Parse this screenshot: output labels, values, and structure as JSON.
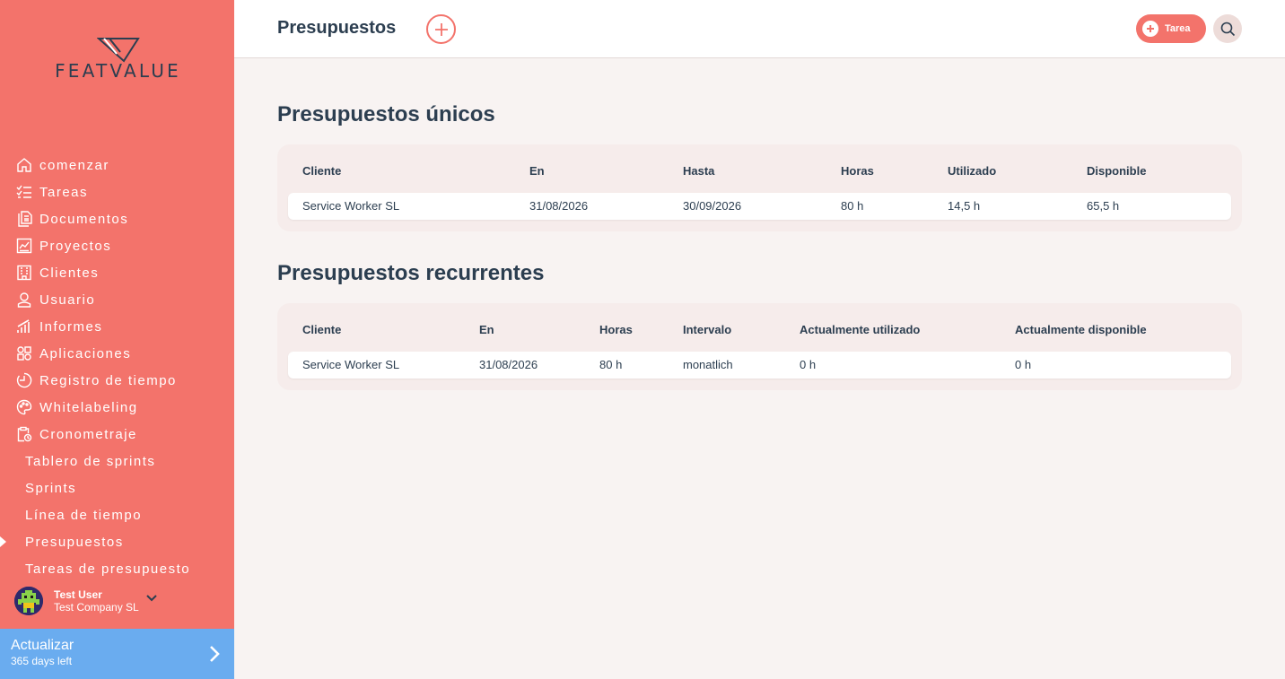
{
  "brand": {
    "name": "FEATVALUE"
  },
  "colors": {
    "sidebar": "#f3736b",
    "accent": "#f3736b",
    "upgrade": "#6aacef",
    "text": "#2c3e50"
  },
  "nav": {
    "items": [
      {
        "label": "comenzar",
        "icon": "home-icon"
      },
      {
        "label": "Tareas",
        "icon": "checklist-icon"
      },
      {
        "label": "Documentos",
        "icon": "documents-icon"
      },
      {
        "label": "Proyectos",
        "icon": "projects-icon"
      },
      {
        "label": "Clientes",
        "icon": "building-icon"
      },
      {
        "label": "Usuario",
        "icon": "user-icon"
      },
      {
        "label": "Informes",
        "icon": "reports-icon"
      },
      {
        "label": "Aplicaciones",
        "icon": "apps-icon"
      },
      {
        "label": "Registro de tiempo",
        "icon": "timer-icon"
      },
      {
        "label": "Whitelabeling",
        "icon": "palette-icon"
      },
      {
        "label": "Cronometraje",
        "icon": "clipboard-clock-icon"
      }
    ],
    "sub_items": [
      {
        "label": "Tablero de sprints"
      },
      {
        "label": "Sprints"
      },
      {
        "label": "Línea de tiempo"
      },
      {
        "label": "Presupuestos",
        "active": true
      },
      {
        "label": "Tareas de presupuesto"
      }
    ]
  },
  "user": {
    "name": "Test User",
    "company": "Test Company SL"
  },
  "upgrade": {
    "title": "Actualizar",
    "subtitle": "365 days left"
  },
  "header": {
    "title": "Presupuestos",
    "task_label": "Tarea"
  },
  "unique": {
    "title": "Presupuestos únicos",
    "headers": [
      "Cliente",
      "En",
      "Hasta",
      "Horas",
      "Utilizado",
      "Disponible"
    ],
    "rows": [
      [
        "Service Worker SL",
        "31/08/2026",
        "30/09/2026",
        "80 h",
        "14,5 h",
        "65,5 h"
      ]
    ]
  },
  "recurring": {
    "title": "Presupuestos recurrentes",
    "headers": [
      "Cliente",
      "En",
      "Horas",
      "Intervalo",
      "Actualmente utilizado",
      "Actualmente disponible"
    ],
    "rows": [
      [
        "Service Worker SL",
        "31/08/2026",
        "80 h",
        "monatlich",
        "0 h",
        "0 h"
      ]
    ]
  }
}
